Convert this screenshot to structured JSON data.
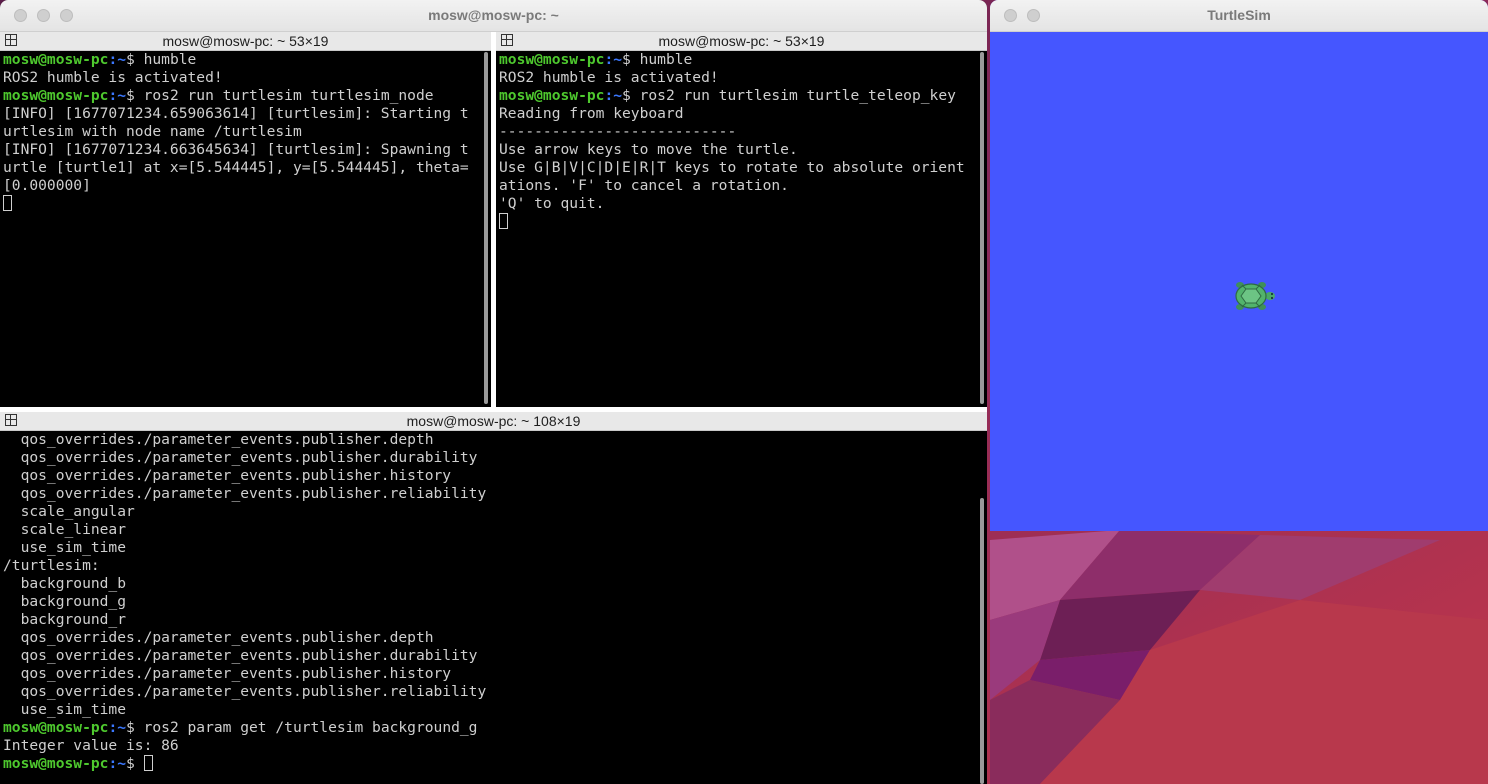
{
  "terminal_window": {
    "title": "mosw@mosw-pc: ~"
  },
  "pane_top_left": {
    "title": "mosw@mosw-pc: ~ 53×19",
    "lines": [
      {
        "user": "mosw@mosw-pc",
        "path": ":~",
        "cmd": "$ humble"
      },
      {
        "text": "ROS2 humble is activated!"
      },
      {
        "user": "mosw@mosw-pc",
        "path": ":~",
        "cmd": "$ ros2 run turtlesim turtlesim_node"
      },
      {
        "text": "[INFO] [1677071234.659063614] [turtlesim]: Starting t"
      },
      {
        "text": "urtlesim with node name /turtlesim"
      },
      {
        "text": "[INFO] [1677071234.663645634] [turtlesim]: Spawning t"
      },
      {
        "text": "urtle [turtle1] at x=[5.544445], y=[5.544445], theta="
      },
      {
        "text": "[0.000000]"
      }
    ]
  },
  "pane_top_right": {
    "title": "mosw@mosw-pc: ~ 53×19",
    "lines": [
      {
        "user": "mosw@mosw-pc",
        "path": ":~",
        "cmd": "$ humble"
      },
      {
        "text": "ROS2 humble is activated!"
      },
      {
        "user": "mosw@mosw-pc",
        "path": ":~",
        "cmd": "$ ros2 run turtlesim turtle_teleop_key"
      },
      {
        "text": "Reading from keyboard"
      },
      {
        "text": "---------------------------"
      },
      {
        "text": "Use arrow keys to move the turtle."
      },
      {
        "text": "Use G|B|V|C|D|E|R|T keys to rotate to absolute orient"
      },
      {
        "text": "ations. 'F' to cancel a rotation."
      },
      {
        "text": "'Q' to quit."
      }
    ]
  },
  "pane_bottom": {
    "title": "mosw@mosw-pc: ~ 108×19",
    "lines": [
      {
        "text": "  qos_overrides./parameter_events.publisher.depth"
      },
      {
        "text": "  qos_overrides./parameter_events.publisher.durability"
      },
      {
        "text": "  qos_overrides./parameter_events.publisher.history"
      },
      {
        "text": "  qos_overrides./parameter_events.publisher.reliability"
      },
      {
        "text": "  scale_angular"
      },
      {
        "text": "  scale_linear"
      },
      {
        "text": "  use_sim_time"
      },
      {
        "text": "/turtlesim:"
      },
      {
        "text": "  background_b"
      },
      {
        "text": "  background_g"
      },
      {
        "text": "  background_r"
      },
      {
        "text": "  qos_overrides./parameter_events.publisher.depth"
      },
      {
        "text": "  qos_overrides./parameter_events.publisher.durability"
      },
      {
        "text": "  qos_overrides./parameter_events.publisher.history"
      },
      {
        "text": "  qos_overrides./parameter_events.publisher.reliability"
      },
      {
        "text": "  use_sim_time"
      },
      {
        "user": "mosw@mosw-pc",
        "path": ":~",
        "cmd": "$ ros2 param get /turtlesim background_g"
      },
      {
        "text": "Integer value is: 86"
      },
      {
        "user": "mosw@mosw-pc",
        "path": ":~",
        "cmd": "$ "
      }
    ]
  },
  "turtlesim_window": {
    "title": "TurtleSim",
    "background_color": "#4556ff"
  },
  "colors": {
    "prompt_user": "#4ec92e",
    "prompt_path": "#3b78ff",
    "terminal_text": "#cfcfcf"
  }
}
